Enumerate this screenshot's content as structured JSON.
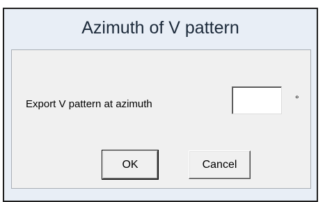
{
  "window": {
    "title": "Azimuth of V pattern"
  },
  "form": {
    "prompt_label": "Export V pattern at azimuth",
    "azimuth_value": "",
    "unit_symbol": "°"
  },
  "buttons": {
    "ok_label": "OK",
    "cancel_label": "Cancel"
  },
  "colors": {
    "title_bar": "#e8eef6",
    "client_area": "#f0f0f0",
    "window_border": "#1e1e1e"
  }
}
